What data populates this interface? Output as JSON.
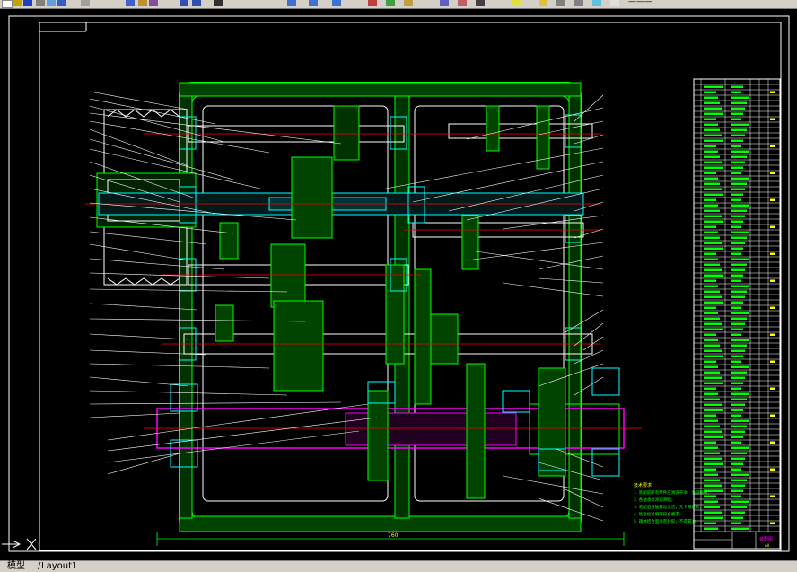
{
  "tabs": {
    "model": "模型",
    "separator": "/",
    "layout": "Layout1",
    "end": "/"
  },
  "toolbar": {
    "right_text": "———"
  },
  "drawing": {
    "dimension_width": "760",
    "notes_title": "技术要求",
    "notes": [
      "1. 装配前所有零件应清洗干净，油道畅通；",
      "2. 各轴承处涂润滑脂；",
      "3. 装配后各轴转动灵活，无卡滞现象；",
      "4. 啮合齿轮侧隙符合要求；",
      "5. 箱体结合面涂密封胶，不得漏油。"
    ],
    "title_block_name": "装配图",
    "title_block_sheet": "A0"
  },
  "colors": {
    "background": "#000000",
    "outline": "#ffffff",
    "body": "#00ff00",
    "centerline": "#ff0000",
    "highlight": "#00ffff",
    "magenta": "#ff00ff",
    "yellow": "#ffff00",
    "ui_gray": "#d4d0c8"
  }
}
